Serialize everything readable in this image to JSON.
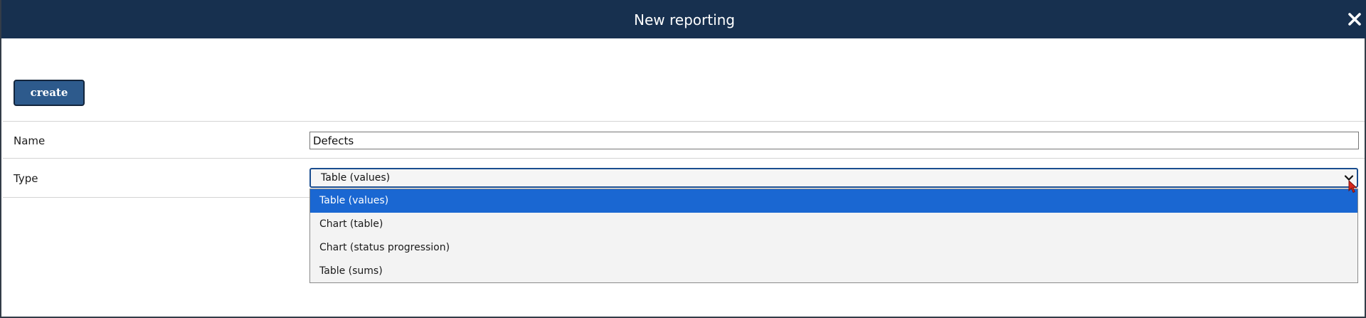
{
  "dialog": {
    "title": "New reporting",
    "close_icon": "close-icon"
  },
  "toolbar": {
    "create_label": "create"
  },
  "form": {
    "name_label": "Name",
    "name_value": "Defects",
    "type_label": "Type",
    "type_selected": "Table (values)",
    "type_options": [
      "Table (values)",
      "Chart (table)",
      "Chart (status progression)",
      "Table (sums)"
    ]
  },
  "colors": {
    "titlebar": "#17304f",
    "button": "#2d5a8c",
    "selected_option": "#1a67d2",
    "select_border": "#1a4d8f"
  }
}
